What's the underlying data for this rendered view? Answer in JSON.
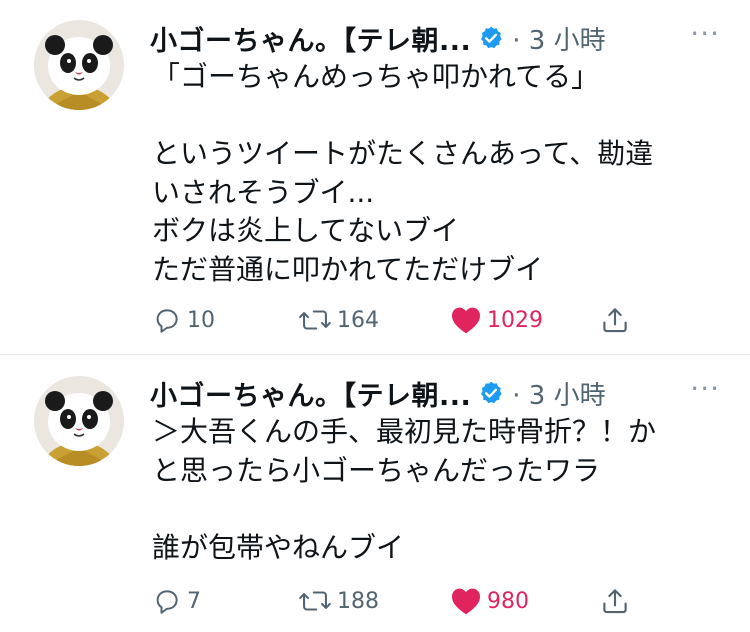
{
  "tweets": [
    {
      "author_name": "小ゴーちゃん。【テレ朝...",
      "meta": "· 3 小時",
      "more_icon": "more-dots-icon",
      "text": "「ゴーちゃんめっちゃ叩かれてる」\n\nというツイートがたくさんあって、勘違\nいされそうブイ...\nボクは炎上してないブイ\nただ普通に叩かれてただけブイ",
      "replies": "10",
      "retweets": "164",
      "likes": "1029"
    },
    {
      "author_name": "小ゴーちゃん。【テレ朝...",
      "meta": "· 3 小時",
      "more_icon": "more-dots-icon",
      "text": "＞大吾くんの手、最初見た時骨折？！か\nと思ったら小ゴーちゃんだったワラ\n\n誰が包帯やねんブイ",
      "replies": "7",
      "retweets": "188",
      "likes": "980"
    }
  ],
  "colors": {
    "like": "#e0245e",
    "verified": "#1d9bf0",
    "secondary_text": "#536471",
    "divider": "#e6ecf0"
  }
}
